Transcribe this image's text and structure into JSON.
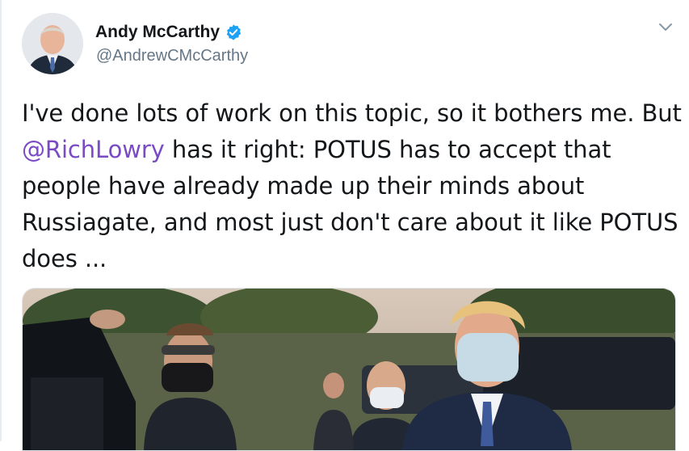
{
  "tweet": {
    "author": {
      "display_name": "Andy McCarthy",
      "handle": "@AndrewCMcCarthy",
      "verified": true,
      "verified_color": "#1da1f2"
    },
    "menu_icon": "chevron-down-icon",
    "text": {
      "segment_1": "I've done lots of work on this topic, so it bothers me. But ",
      "mention": "@RichLowry",
      "segment_2": " has it right: POTUS has to accept that people have already made up their minds about Russiagate, and most just don't care about it like POTUS does ..."
    },
    "mention_color": "#794bc4",
    "media": {
      "type": "photo"
    }
  }
}
